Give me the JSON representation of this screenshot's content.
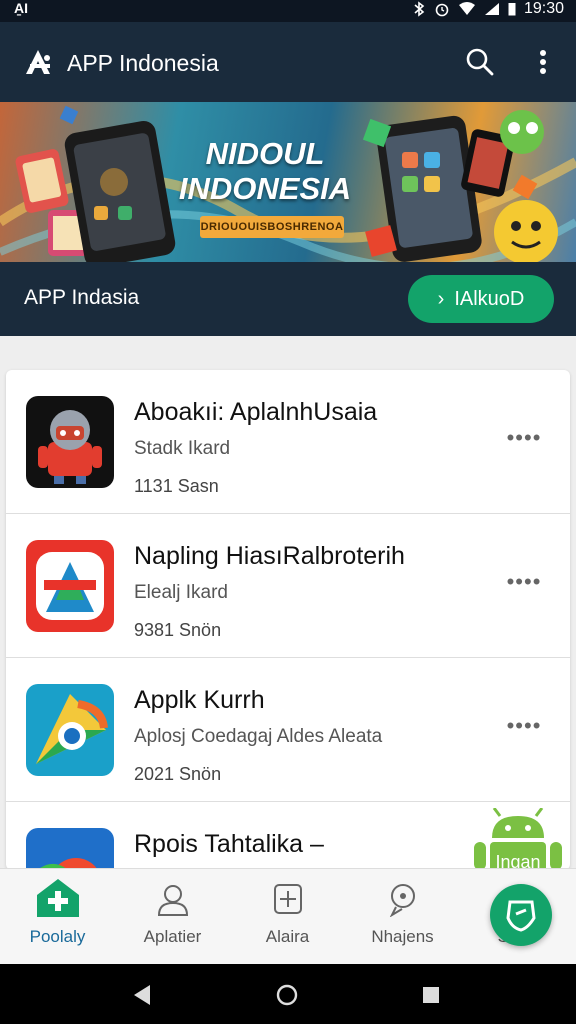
{
  "status_bar": {
    "carrier": "A̱I",
    "time": "19:30"
  },
  "app_bar": {
    "title": "APP Indonesia"
  },
  "banner": {
    "title_line1": "NIDOUL",
    "title_line2": "INDONESIA",
    "subtitle": "DRIOUOUISBOSHRENOA"
  },
  "hero": {
    "title": "APP Indasia",
    "button_label": "IAlkuoD"
  },
  "apps": [
    {
      "name": "Aboakıi: AplalnhUsaia",
      "subtitle": "Stadk Ikard",
      "meta": "1131 Sasn"
    },
    {
      "name": "Napling HiasıRalbroterih",
      "subtitle": "Elealj Ikard",
      "meta": "9381 Snön"
    },
    {
      "name": "Applk Kurrh",
      "subtitle": "Aplosj Coedagaj Aldes Aleata",
      "meta": "2021 Snön"
    },
    {
      "name": "Rpois Tahtalika –",
      "subtitle": "",
      "meta": ""
    }
  ],
  "row_menu": "••••",
  "badge_text": "Ingan",
  "bottom_nav": [
    {
      "label": "Poolaly",
      "icon": "home-plus-icon",
      "active": true
    },
    {
      "label": "Aplatier",
      "icon": "person-icon",
      "active": false
    },
    {
      "label": "Alaira",
      "icon": "plus-box-icon",
      "active": false
    },
    {
      "label": "Nhajens",
      "icon": "location-pin-icon",
      "active": false
    },
    {
      "label": "Sh..n",
      "icon": "shield-icon",
      "active": false
    }
  ],
  "colors": {
    "primary_dark": "#1a2b3c",
    "accent_green": "#13a36a"
  }
}
